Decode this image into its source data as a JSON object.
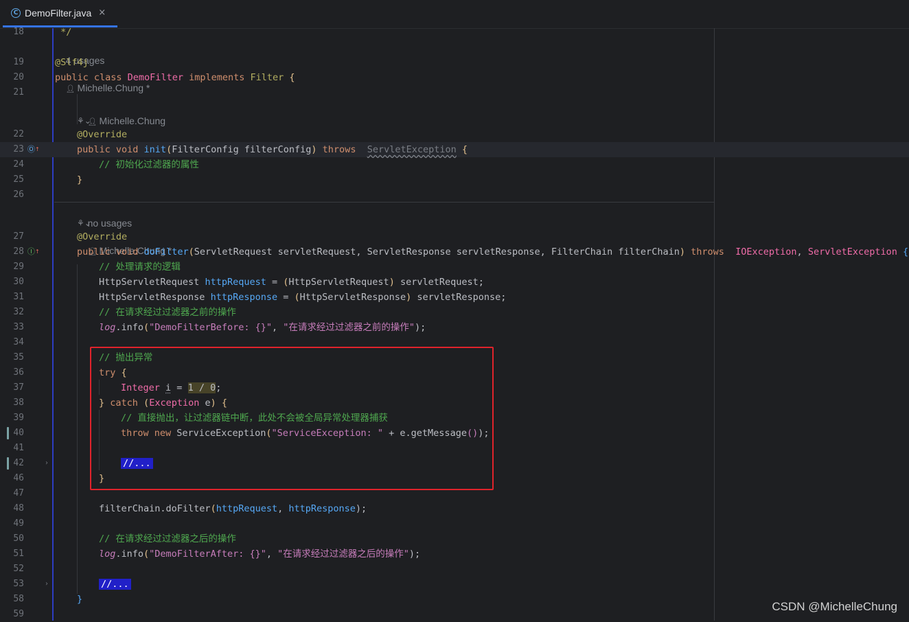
{
  "tab": {
    "icon": "C",
    "filename": "DemoFilter.java",
    "close": "×"
  },
  "gutter": {
    "line_numbers": [
      "18",
      "19",
      "20",
      "21",
      "22",
      "23",
      "24",
      "25",
      "26",
      "27",
      "28",
      "29",
      "30",
      "31",
      "32",
      "33",
      "34",
      "35",
      "36",
      "37",
      "38",
      "39",
      "40",
      "41",
      "42",
      "46",
      "47",
      "48",
      "49",
      "50",
      "51",
      "52",
      "53",
      "58",
      "59"
    ]
  },
  "inlay": {
    "class_usages": "4 usages",
    "class_author": "Michelle.Chung *",
    "init_author": "Michelle.Chung",
    "dofilter_usages": "no usages",
    "dofilter_author": "Michelle.Chung *"
  },
  "code": {
    "l18": " */",
    "l19": "@Slf4j",
    "l20": [
      "public class ",
      "DemoFilter",
      " implements ",
      "Filter",
      " {"
    ],
    "l22": "@Override",
    "l23": [
      "public void ",
      "init",
      "(",
      "FilterConfig filterConfig",
      ")",
      " throws ",
      "ServletException",
      " {"
    ],
    "l24": "// 初始化过滤器的属性",
    "l25": "}",
    "l27": "@Override",
    "l28": [
      "public void ",
      "doFilter",
      "(",
      "ServletRequest servletRequest, ServletResponse servletResponse, FilterChain filterChain",
      ")",
      " throws ",
      "IOException",
      ", ",
      "ServletException",
      " {"
    ],
    "l29": "// 处理请求的逻辑",
    "l30": [
      "HttpServletRequest ",
      "httpRequest",
      " = ",
      "(",
      "HttpServletRequest",
      ")",
      " servletRequest;"
    ],
    "l31": [
      "HttpServletResponse ",
      "httpResponse",
      " = ",
      "(",
      "HttpServletResponse",
      ")",
      " servletResponse;"
    ],
    "l32": "// 在请求经过过滤器之前的操作",
    "l33": [
      "log",
      ".info",
      "(",
      "\"DemoFilterBefore: {}\"",
      ", ",
      "\"在请求经过过滤器之前的操作\"",
      ");"
    ],
    "l35": "// 抛出异常",
    "l36": [
      "try",
      " {"
    ],
    "l37": [
      "Integer ",
      "i",
      " = ",
      "1 / 0",
      ";"
    ],
    "l38": [
      "}",
      " catch ",
      "(",
      "Exception",
      " e",
      ")",
      " {"
    ],
    "l39": "// 直接抛出，让过滤器链中断，此处不会被全局异常处理器捕获",
    "l40": [
      "throw new ",
      "ServiceException",
      "(",
      "\"ServiceException: \"",
      " + e.getMessage",
      "()",
      ");"
    ],
    "l42": "//...",
    "l46": "}",
    "l48": [
      "filterChain.doFilter",
      "(",
      "httpRequest",
      ", ",
      "httpResponse",
      ");"
    ],
    "l50": "// 在请求经过过滤器之后的操作",
    "l51": [
      "log",
      ".info",
      "(",
      "\"DemoFilterAfter: {}\"",
      ", ",
      "\"在请求经过过滤器之后的操作\"",
      ");"
    ],
    "l53": "//...",
    "l58": "}"
  },
  "watermark": "CSDN @MichelleChung"
}
